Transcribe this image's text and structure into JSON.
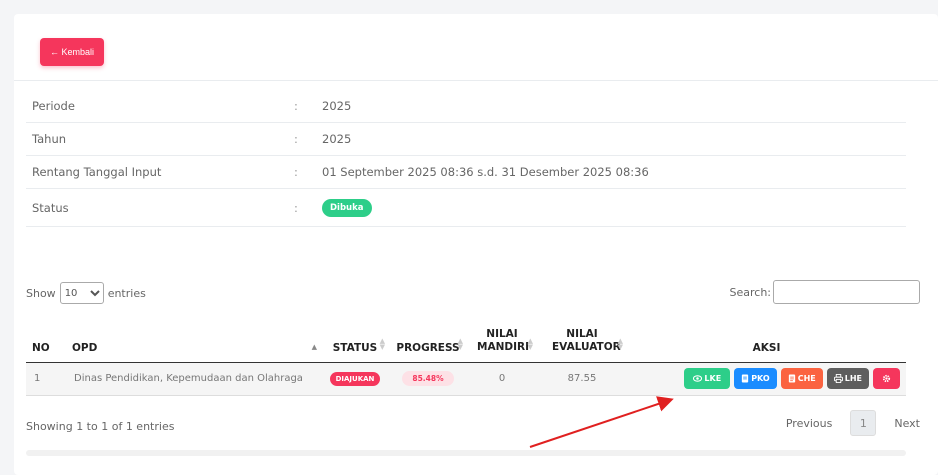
{
  "header": {
    "back_label": "← Kembali"
  },
  "info": {
    "rows": [
      {
        "label": "Periode",
        "colon": ":",
        "value": "2025"
      },
      {
        "label": "Tahun",
        "colon": ":",
        "value": "2025"
      },
      {
        "label": "Rentang Tanggal Input",
        "colon": ":",
        "value": "01 September 2025 08:36 s.d. 31 Desember 2025 08:36"
      },
      {
        "label": "Status",
        "colon": ":",
        "value": "Dibuka"
      }
    ]
  },
  "table_controls": {
    "show_label": "Show",
    "entries_value": "10",
    "entries_label": "entries",
    "search_label": "Search:",
    "search_value": ""
  },
  "table": {
    "headers": [
      "NO",
      "OPD",
      "STATUS",
      "PROGRESS",
      "NILAI MANDIRI",
      "NILAI EVALUATOR",
      "AKSI"
    ],
    "rows": [
      {
        "no": "1",
        "opd": "Dinas Pendidikan, Kepemudaan dan Olahraga",
        "status": "DIAJUKAN",
        "progress": "85.48%",
        "mandiri": "0",
        "evaluator": "87.55"
      }
    ],
    "actions": {
      "lke": "LKE",
      "pko": "PKO",
      "che": "CHE",
      "lhe": "LHE"
    }
  },
  "footer": {
    "info_text": "Showing 1 to 1 of 1 entries",
    "previous": "Previous",
    "page": "1",
    "next": "Next"
  },
  "colors": {
    "danger": "#f5365c",
    "success": "#2dce89",
    "primary": "#1a8cff",
    "warning": "#fb6340",
    "dark": "#5e5e5e",
    "annotation_arrow": "#e02020"
  },
  "icons": {
    "back": "arrow-left-icon",
    "lke": "eye-icon",
    "pko": "document-icon",
    "che": "checklist-icon",
    "lhe": "print-icon",
    "cfg": "gear-icon"
  }
}
